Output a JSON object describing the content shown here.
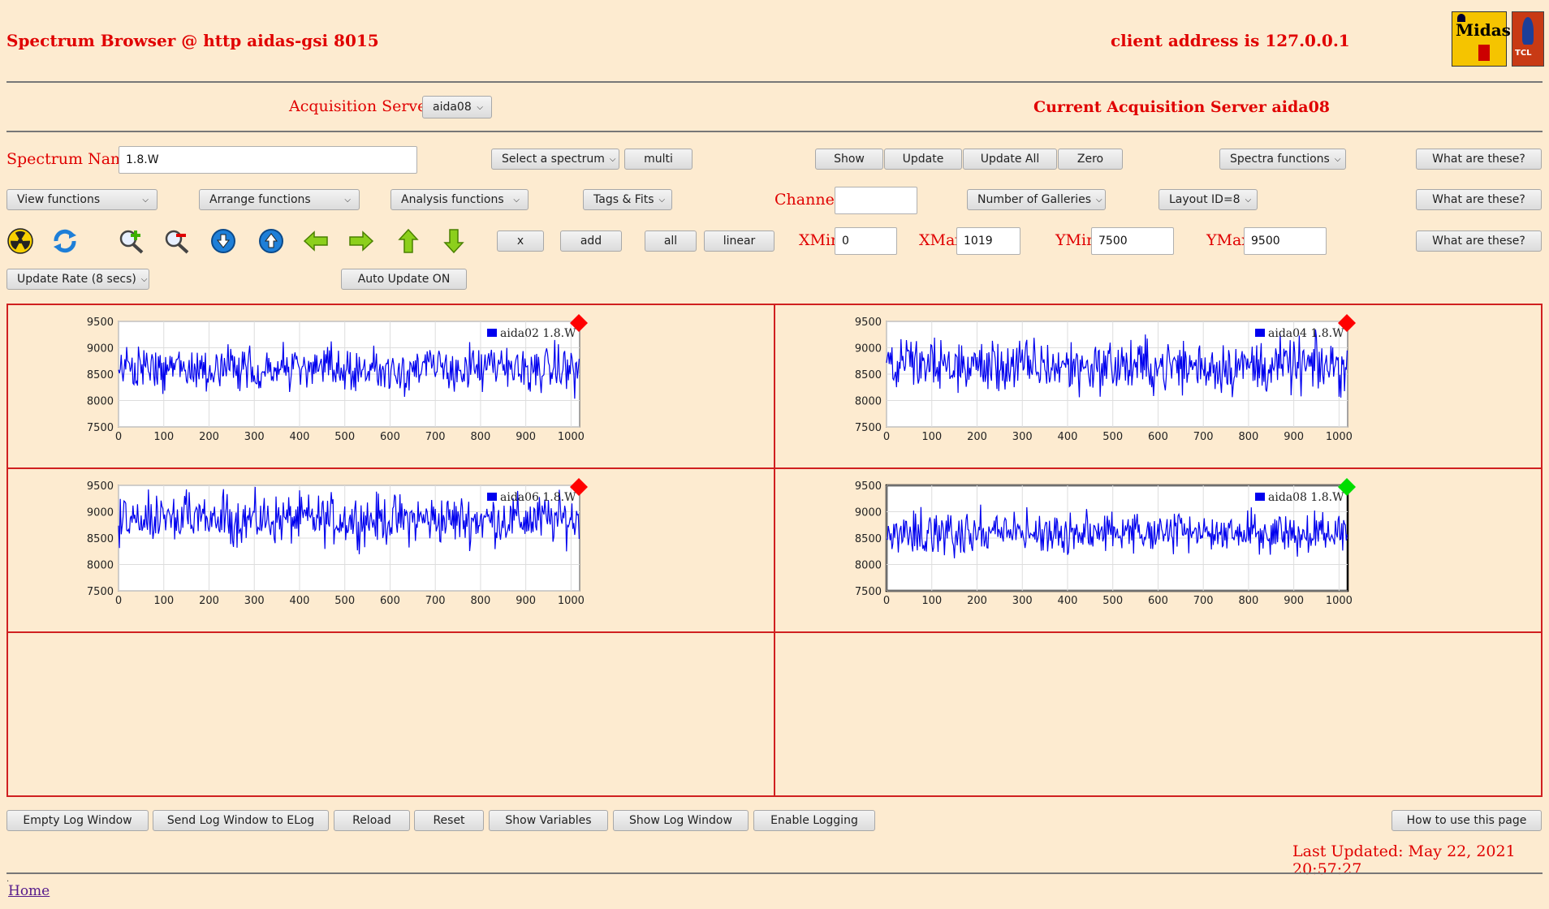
{
  "header": {
    "title": "Spectrum Browser @ http aidas-gsi 8015",
    "client_address": "client address is 127.0.0.1",
    "logo_text": "Midas",
    "tcl_text": "TCL"
  },
  "servers": {
    "label": "Acquisition Servers",
    "selected": "aida08",
    "current": "Current Acquisition Server aida08"
  },
  "spectrum": {
    "label": "Spectrum Name:",
    "value": "1.8.W",
    "select_label": "Select a spectrum",
    "multi": "multi",
    "show": "Show",
    "update": "Update",
    "update_all": "Update All",
    "zero": "Zero",
    "spectra_functions": "Spectra functions",
    "help1": "What are these?"
  },
  "functions": {
    "view": "View functions",
    "arrange": "Arrange functions",
    "analysis": "Analysis functions",
    "tags": "Tags & Fits",
    "channel_label": "Channel:",
    "channel_value": "",
    "galleries": "Number of Galleries",
    "layout": "Layout ID=8",
    "help2": "What are these?"
  },
  "toolbar": {
    "icons": [
      "radiation-icon",
      "refresh-icon",
      "zoom-in-icon",
      "zoom-out-icon",
      "scroll-down-icon",
      "scroll-up-icon",
      "arrow-left-icon",
      "arrow-right-icon",
      "arrow-up-icon",
      "arrow-down-icon"
    ],
    "x": "x",
    "add": "add",
    "all": "all",
    "linear": "linear",
    "xmin_label": "XMin",
    "xmin": "0",
    "xmax_label": "XMax",
    "xmax": "1019",
    "ymin_label": "YMin",
    "ymin": "7500",
    "ymax_label": "YMax",
    "ymax": "9500",
    "help3": "What are these?"
  },
  "update": {
    "rate": "Update Rate (8 secs)",
    "auto": "Auto Update ON"
  },
  "charts": {
    "x_ticks": [
      "0",
      "100",
      "200",
      "300",
      "400",
      "500",
      "600",
      "700",
      "800",
      "900",
      "1000"
    ],
    "y_ticks": [
      "9500",
      "9000",
      "8500",
      "8000",
      "7500"
    ],
    "colors": {
      "series": "#0000ee",
      "inactive": "#ff0000",
      "active": "#00dd00"
    }
  },
  "chart_data": [
    {
      "type": "line",
      "series": [
        {
          "name": "aida02 1.8.W",
          "mean": 8600,
          "spread": 300
        }
      ],
      "xlim": [
        0,
        1019
      ],
      "ylim": [
        7500,
        9500
      ],
      "grid": true,
      "legend": "top-right",
      "status": "inactive"
    },
    {
      "type": "line",
      "series": [
        {
          "name": "aida04 1.8.W",
          "mean": 8650,
          "spread": 360
        }
      ],
      "xlim": [
        0,
        1019
      ],
      "ylim": [
        7500,
        9500
      ],
      "grid": true,
      "legend": "top-right",
      "status": "inactive"
    },
    {
      "type": "line",
      "series": [
        {
          "name": "aida06 1.8.W",
          "mean": 8850,
          "spread": 330
        }
      ],
      "xlim": [
        0,
        1019
      ],
      "ylim": [
        7500,
        9500
      ],
      "grid": true,
      "legend": "top-right",
      "status": "inactive"
    },
    {
      "type": "line",
      "series": [
        {
          "name": "aida08 1.8.W",
          "mean": 8600,
          "spread": 280
        }
      ],
      "xlim": [
        0,
        1019
      ],
      "ylim": [
        7500,
        9500
      ],
      "grid": true,
      "legend": "top-right",
      "status": "active"
    }
  ],
  "footer": {
    "empty_log": "Empty Log Window",
    "send_log": "Send Log Window to ELog",
    "reload": "Reload",
    "reset": "Reset",
    "show_vars": "Show Variables",
    "show_log": "Show Log Window",
    "enable_logging": "Enable Logging",
    "howto": "How to use this page",
    "last_updated": "Last Updated: May 22, 2021 20:57:27",
    "dot": ".",
    "home": "Home"
  }
}
